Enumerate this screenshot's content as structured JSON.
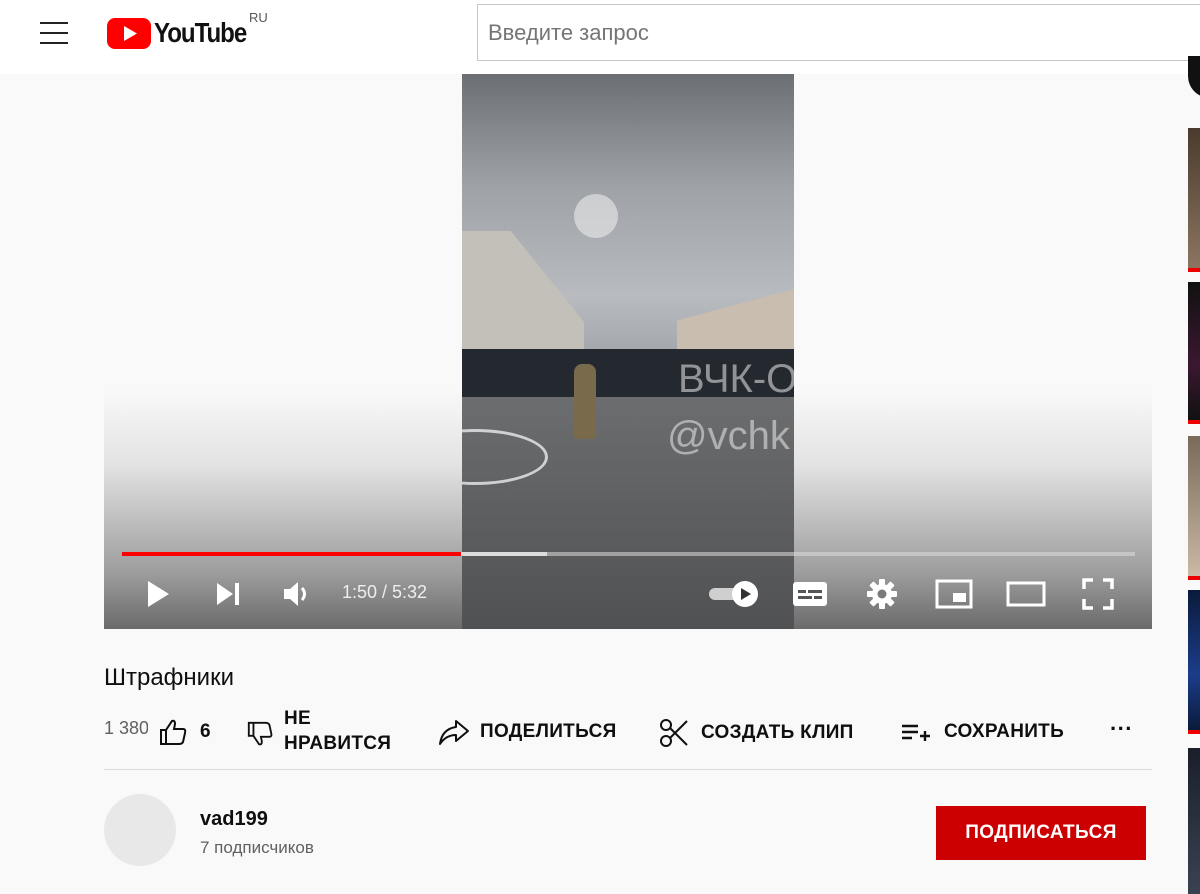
{
  "header": {
    "logo_text": "YouTube",
    "region": "RU",
    "search_placeholder": "Введите запрос"
  },
  "player": {
    "watermark_line1": "ВЧК-О",
    "watermark_line2": "@vchk",
    "time_display": "1:50 / 5:32",
    "progress_played_fraction": 0.335,
    "progress_buffered_fraction": 0.42,
    "autoplay_on": true
  },
  "video": {
    "title": "Штрафники",
    "views": "1 380",
    "likes": "6",
    "dislike_label_line1": "НЕ",
    "dislike_label_line2": "НРАВИТСЯ",
    "share_label": "ПОДЕЛИТЬСЯ",
    "clip_label": "СОЗДАТЬ КЛИП",
    "save_label": "СОХРАНИТЬ",
    "more_label": "···"
  },
  "channel": {
    "name": "vad199",
    "subscribers": "7 подписчиков",
    "subscribe_label": "ПОДПИСАТЬСЯ"
  },
  "colors": {
    "brand_red": "#ff0000",
    "subscribe_red": "#cc0000"
  }
}
